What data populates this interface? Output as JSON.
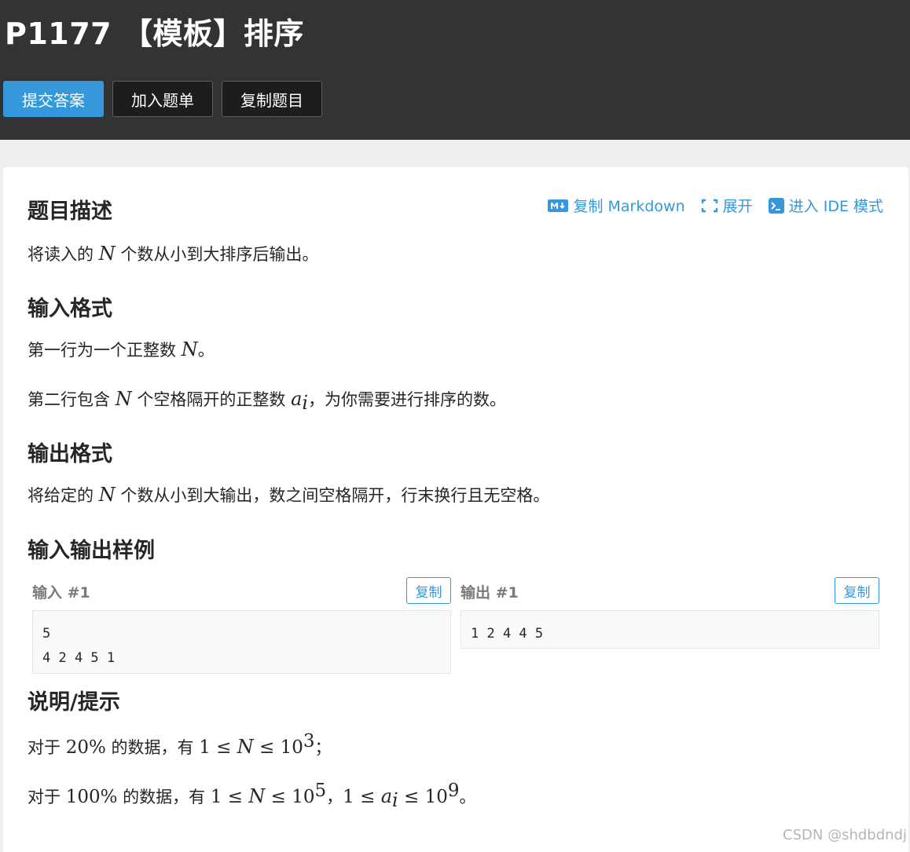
{
  "header": {
    "title": "P1177 【模板】排序",
    "buttons": {
      "submit": "提交答案",
      "add_list": "加入题单",
      "copy_problem": "复制题目"
    }
  },
  "toolbar": {
    "copy_markdown": "复制 Markdown",
    "expand": "展开",
    "ide_mode": "进入 IDE 模式"
  },
  "sections": {
    "description": {
      "heading": "题目描述",
      "text_before": "将读入的",
      "var": "N",
      "text_after": "个数从小到大排序后输出。"
    },
    "input_format": {
      "heading": "输入格式",
      "line1_before": "第一行为一个正整数",
      "line1_var": "N",
      "line1_after": "。",
      "line2_before": "第二行包含",
      "line2_var": "N",
      "line2_mid": "个空格隔开的正整数",
      "line2_var2": "a",
      "line2_sub": "i",
      "line2_after": "，为你需要进行排序的数。"
    },
    "output_format": {
      "heading": "输出格式",
      "text_before": "将给定的",
      "var": "N",
      "text_after": "个数从小到大输出，数之间空格隔开，行末换行且无空格。"
    },
    "samples": {
      "heading": "输入输出样例",
      "input_label": "输入 #1",
      "output_label": "输出 #1",
      "copy_label": "复制",
      "input_content": "5\n4 2 4 5 1",
      "output_content": "1 2 4 4 5"
    },
    "hint": {
      "heading": "说明/提示",
      "line1_a": "对于",
      "line1_pct": "20%",
      "line1_b": "的数据，有",
      "line1_one": "1 ≤ ",
      "line1_N": "N",
      "line1_le": " ≤ 10",
      "line1_exp": "3",
      "line1_end": "；",
      "line2_a": "对于",
      "line2_pct": "100%",
      "line2_b": "的数据，有",
      "line2_one": "1 ≤ ",
      "line2_N": "N",
      "line2_le": " ≤ 10",
      "line2_exp": "5",
      "line2_sep": "，",
      "line2_one2": "1 ≤ ",
      "line2_a_var": "a",
      "line2_a_sub": "i",
      "line2_le2": " ≤ 10",
      "line2_exp2": "9",
      "line2_end": "。"
    }
  },
  "watermark": "CSDN @shdbdndj",
  "colors": {
    "accent": "#3498db",
    "header_bg": "#323335"
  },
  "icons": {
    "markdown": "markdown-icon",
    "expand": "expand-icon",
    "ide": "terminal-icon"
  }
}
